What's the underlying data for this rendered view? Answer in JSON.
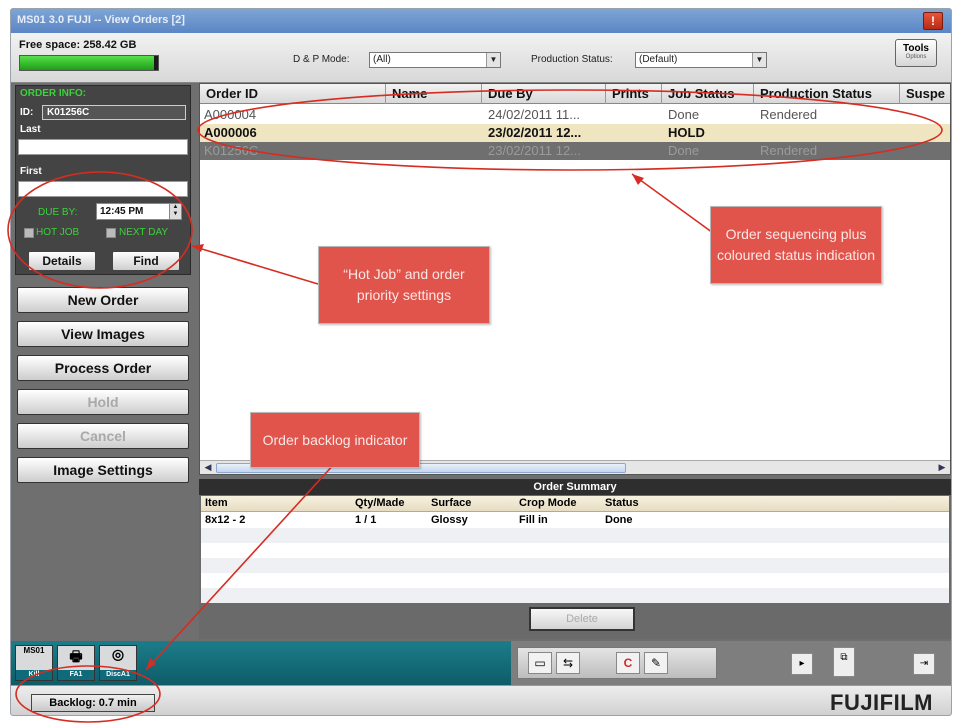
{
  "window": {
    "title": "MS01 3.0  FUJI  -- View Orders  [2]",
    "close_label": "!"
  },
  "toolbar": {
    "free_space": "Free space: 258.42 GB",
    "free_space_fill": 0.97,
    "dp_mode_label": "D & P Mode:",
    "dp_mode_value": "(All)",
    "production_status_label": "Production Status:",
    "production_status_value": "(Default)",
    "tools_label": "Tools",
    "tools_sub": "Options"
  },
  "order_info": {
    "heading": "ORDER INFO:",
    "id_label": "ID:",
    "id_value": "K01256C",
    "last_label": "Last",
    "first_label": "First",
    "due_by_label": "DUE BY:",
    "due_by_value": "12:45 PM",
    "hot_job_label": "HOT JOB",
    "next_day_label": "NEXT DAY",
    "details_label": "Details",
    "find_label": "Find"
  },
  "actions": {
    "new_order": "New Order",
    "view_images": "View Images",
    "process_order": "Process Order",
    "hold": "Hold",
    "cancel": "Cancel",
    "image_settings": "Image Settings"
  },
  "orders_table": {
    "columns": [
      "Order ID",
      "Name",
      "Due By",
      "Prints",
      "Job Status",
      "Production Status",
      "Suspe"
    ],
    "rows": [
      {
        "order_id": "A000004",
        "name": "",
        "due_by": "24/02/2011  11...",
        "prints": "",
        "job_status": "Done",
        "production_status": "Rendered"
      },
      {
        "order_id": "A000006",
        "name": "",
        "due_by": "23/02/2011  12...",
        "prints": "",
        "job_status": "HOLD",
        "production_status": ""
      },
      {
        "order_id": "K01256C",
        "name": "",
        "due_by": "23/02/2011  12...",
        "prints": "",
        "job_status": "Done",
        "production_status": "Rendered"
      }
    ]
  },
  "order_summary": {
    "title": "Order Summary",
    "columns": [
      "Item",
      "Qty/Made",
      "Surface",
      "Crop Mode",
      "Status"
    ],
    "rows": [
      {
        "item": "8x12 - 2",
        "qty": "1 / 1",
        "surface": "Glossy",
        "crop": "Fill in",
        "status": "Done"
      }
    ],
    "delete_label": "Delete"
  },
  "devices": [
    {
      "name": "MS01",
      "label": "Kill"
    },
    {
      "name": "",
      "label": "FA1"
    },
    {
      "name": "",
      "label": "DiscA1"
    }
  ],
  "status": {
    "backlog": "Backlog: 0.7 min",
    "brand": "FUJIFILM"
  },
  "annotations": {
    "order_sequencing": "Order sequencing plus coloured status indication",
    "hot_job": "“Hot Job” and order priority settings",
    "backlog": "Order backlog indicator"
  },
  "colors": {
    "annotation_red": "#e1544c",
    "status_green": "#3cd23c",
    "hold_row": "#efe5c0",
    "selected_row": "#6f6f6f"
  }
}
